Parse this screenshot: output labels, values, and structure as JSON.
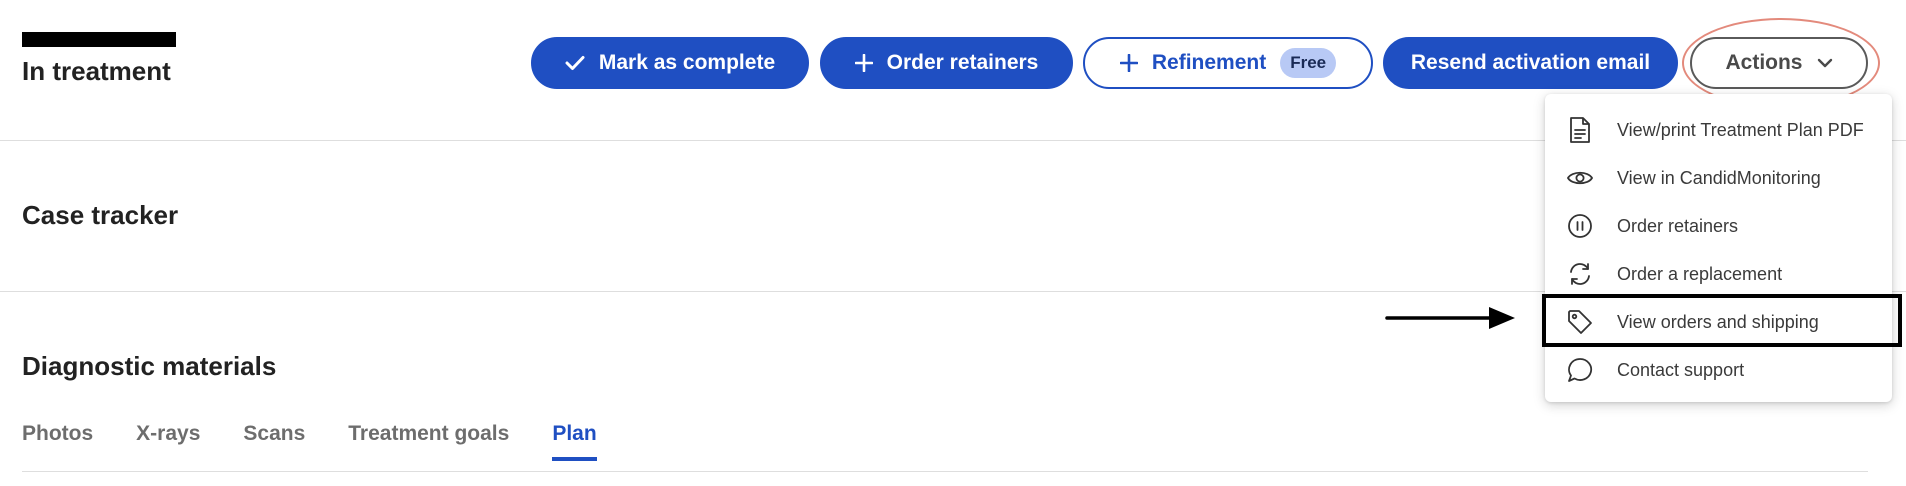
{
  "header": {
    "status_title": "In treatment"
  },
  "actions_bar": {
    "mark_complete_label": "Mark as complete",
    "order_retainers_label": "Order retainers",
    "refinement_label": "Refinement",
    "refinement_badge": "Free",
    "resend_label": "Resend activation email",
    "actions_label": "Actions"
  },
  "actions_menu": {
    "items": [
      {
        "label": "View/print Treatment Plan PDF",
        "icon": "document-icon"
      },
      {
        "label": "View in CandidMonitoring",
        "icon": "eye-icon"
      },
      {
        "label": "Order retainers",
        "icon": "pause-circle-icon"
      },
      {
        "label": "Order a replacement",
        "icon": "refresh-icon"
      },
      {
        "label": "View orders and shipping",
        "icon": "tag-icon"
      },
      {
        "label": "Contact support",
        "icon": "chat-bubble-icon"
      }
    ]
  },
  "sections": {
    "case_tracker": "Case tracker",
    "diagnostic_materials": "Diagnostic materials"
  },
  "tabs": [
    {
      "label": "Photos"
    },
    {
      "label": "X-rays"
    },
    {
      "label": "Scans"
    },
    {
      "label": "Treatment goals"
    },
    {
      "label": "Plan",
      "active": true
    }
  ],
  "colors": {
    "primary": "#1f4fc2",
    "badge_bg": "#b8c9f5",
    "highlight_oval": "#e38a7c"
  }
}
